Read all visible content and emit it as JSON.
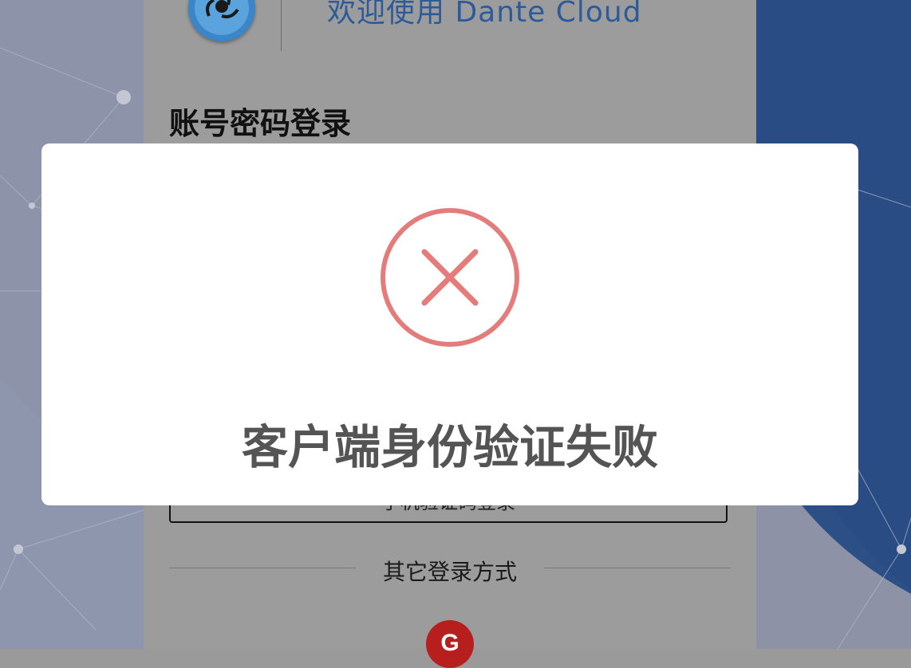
{
  "header": {
    "welcome_text": "欢迎使用 Dante Cloud"
  },
  "login": {
    "title": "账号密码登录",
    "phone_login_button": "手机验证码登录",
    "other_methods_label": "其它登录方式",
    "gitee_icon_letter": "G"
  },
  "modal": {
    "icon": "error-x-circle-icon",
    "title": "客户端身份验证失败"
  },
  "colors": {
    "error_accent": "#e47c7c",
    "modal_text": "#545454",
    "brand_blue": "#2c5a9a",
    "gitee_red": "#b71e1e"
  }
}
